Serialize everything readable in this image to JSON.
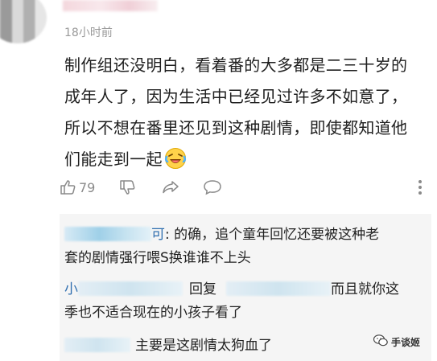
{
  "comment": {
    "time": "18小时前",
    "lines": [
      "制作组还没明白，看着番的大多都是二三十岁的",
      "成年人了，因为生活中已经见过许多不如意了，",
      "所以不想在番里还见到这种剧情，即使都知道他",
      "们能走到一起"
    ],
    "like_count": "79"
  },
  "replies": [
    {
      "name_tail": "可",
      "colon": ": ",
      "text_line1": "的确，追个童年回忆还要被这种老",
      "text_line2": "套的剧情强行喂S换谁谁不上头"
    },
    {
      "name_head": "小",
      "reply_word": "回复",
      "text_line1": "而且就你这",
      "text_line2": "季也不适合现在的小孩子看了"
    },
    {
      "text": "主要是这剧情太狗血了"
    }
  ],
  "watermark": {
    "label": "手谈姬"
  },
  "icons": {
    "like": "thumbs-up-icon",
    "dislike": "thumbs-down-icon",
    "share": "share-icon",
    "reply": "comment-icon",
    "more": "more-vertical-icon",
    "emoji": "laughing-tears-emoji"
  }
}
